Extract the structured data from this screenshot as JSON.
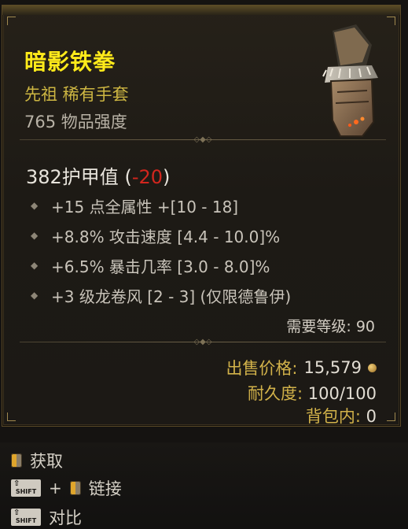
{
  "item": {
    "name": "暗影铁拳",
    "rarity": "先祖 稀有手套",
    "item_power": "765 物品强度",
    "icon": "gauntlet-icon",
    "armor_value": "382护甲值",
    "armor_open": " (",
    "armor_diff": "-20",
    "armor_close": ")",
    "affixes": [
      "+15 点全属性 +[10 - 18]",
      "+8.8% 攻击速度 [4.4 - 10.0]%",
      "+6.5% 暴击几率 [3.0 - 8.0]%",
      "+3 级龙卷风 [2 - 3] (仅限德鲁伊)"
    ],
    "required_level": "需要等级: 90",
    "sell_label": "出售价格:",
    "sell_value": "15,579",
    "durability_label": "耐久度:",
    "durability_value": "100/100",
    "in_bag_label": "背包内:",
    "in_bag_value": "0"
  },
  "actions": {
    "acquire": "获取",
    "link": "链接",
    "compare": "对比",
    "shift_key": "SHIFT",
    "plus": "+"
  },
  "colors": {
    "name": "#ffea1a",
    "rarity": "#cdb642",
    "negative": "#d2261e",
    "label_gold": "#d2b24a"
  }
}
